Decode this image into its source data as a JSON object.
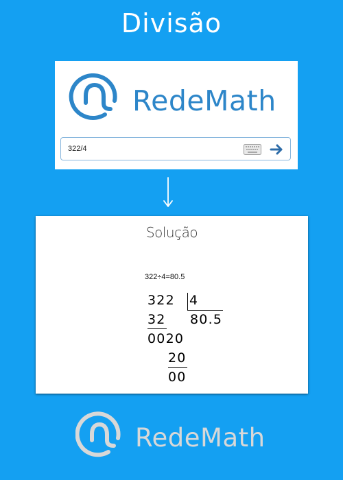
{
  "page": {
    "title": "Divisão"
  },
  "search": {
    "brand": "RedeMath",
    "input_value": "322/4",
    "keyboard_icon": "keyboard-icon",
    "submit_icon": "arrow-right-icon"
  },
  "flow": {
    "icon": "arrow-down-icon"
  },
  "solution": {
    "title": "Solução",
    "equation": "322÷4=80.5",
    "long_division": {
      "dividend": "322",
      "divisor": "4",
      "quotient": "80.5",
      "step1_subtrahend": "32",
      "step1_remainder": "0020",
      "step2_subtrahend": "20",
      "step2_remainder": "00"
    }
  },
  "footer": {
    "brand": "RedeMath"
  },
  "colors": {
    "background": "#14a0f2",
    "brand_blue": "#2d86c9",
    "footer_logo": "#d8d8d8"
  }
}
